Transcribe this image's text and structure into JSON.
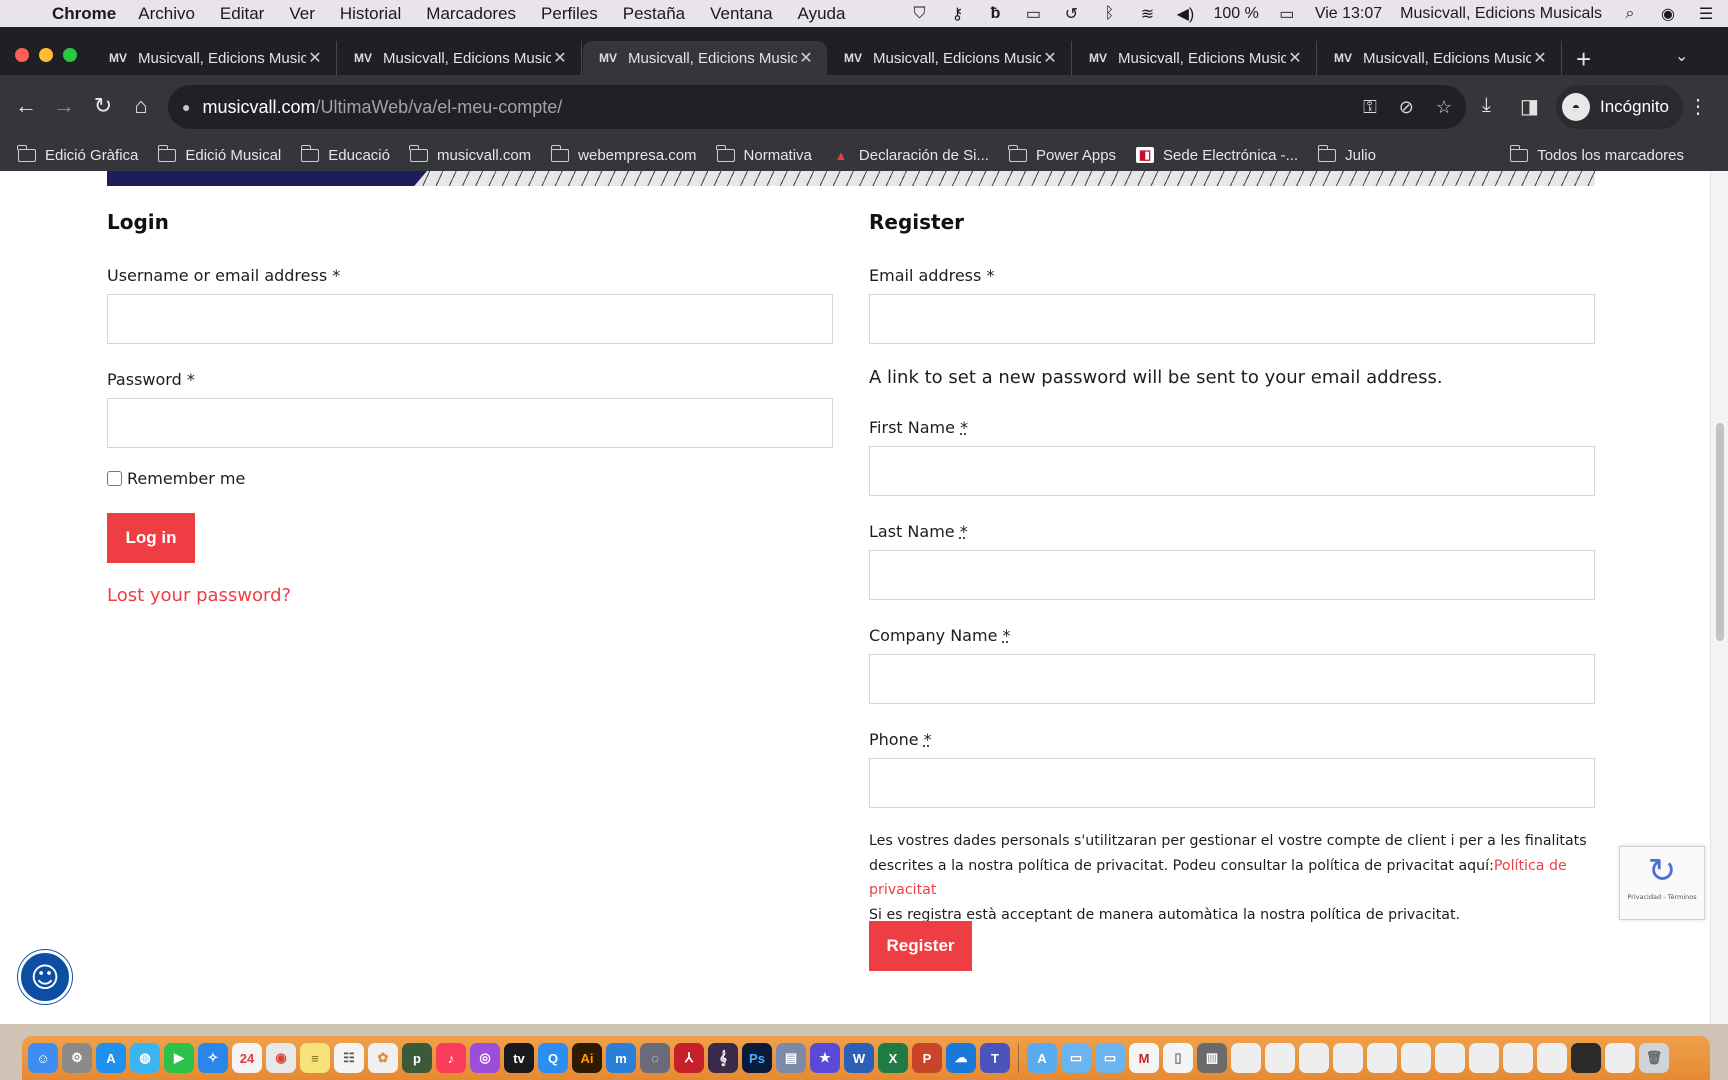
{
  "menubar": {
    "app": "Chrome",
    "items": [
      "Archivo",
      "Editar",
      "Ver",
      "Historial",
      "Marcadores",
      "Perfiles",
      "Pestaña",
      "Ventana",
      "Ayuda"
    ],
    "battery": "100 %",
    "clock": "Vie 13:07",
    "window_title": "Musicvall, Edicions Musicals"
  },
  "tabs": [
    {
      "title": "Musicvall, Edicions Musicals",
      "active": false
    },
    {
      "title": "Musicvall, Edicions Musicals",
      "active": false
    },
    {
      "title": "Musicvall, Edicions Musicals",
      "active": true
    },
    {
      "title": "Musicvall, Edicions Musicals",
      "active": false
    },
    {
      "title": "Musicvall, Edicions Musicals",
      "active": false
    },
    {
      "title": "Musicvall, Edicions Musicals",
      "active": false
    }
  ],
  "address": {
    "host": "musicvall.com",
    "path": "/UltimaWeb/va/el-meu-compte/"
  },
  "profile": {
    "label": "Incógnito"
  },
  "bookmarks": [
    {
      "label": "Edició Gràfica",
      "icon": "folder-icon"
    },
    {
      "label": "Edició Musical",
      "icon": "folder-icon"
    },
    {
      "label": "Educació",
      "icon": "folder-icon"
    },
    {
      "label": "musicvall.com",
      "icon": "folder-icon"
    },
    {
      "label": "webempresa.com",
      "icon": "folder-icon"
    },
    {
      "label": "Normativa",
      "icon": "folder-icon"
    },
    {
      "label": "Declaración de Si...",
      "icon": "aeat-icon"
    },
    {
      "label": "Power Apps",
      "icon": "folder-icon"
    },
    {
      "label": "Sede Electrónica -...",
      "icon": "sede-icon"
    },
    {
      "label": "Julio",
      "icon": "folder-icon"
    }
  ],
  "bookmarks_all": "Todos los marcadores",
  "login": {
    "heading": "Login",
    "username_label": "Username or email address",
    "password_label": "Password",
    "required_mark": "*",
    "remember_label": "Remember me",
    "login_button": "Log in",
    "lost_password": "Lost your password?"
  },
  "register": {
    "heading": "Register",
    "email_label": "Email address",
    "password_note": "A link to set a new password will be sent to your email address.",
    "first_name_label": "First Name",
    "last_name_label": "Last Name",
    "company_label": "Company Name",
    "phone_label": "Phone",
    "required_mark": "*",
    "privacy_text_1": "Les vostres dades personals s'utilitzaran per gestionar el vostre compte de client i per a les finalitats descrites a la nostra política de privacitat. Podeu consultar la política de privacitat aquí:",
    "privacy_link": "Política de privacitat",
    "privacy_text_2": "Si es registra està acceptant de manera automàtica la nostra política de privacitat.",
    "register_button": "Register"
  },
  "recaptcha": {
    "footer": "Privacidad - Términos"
  },
  "colors": {
    "accent": "#ee3e44",
    "chrome_dark": "#35363a",
    "tabstrip": "#1f2023"
  }
}
